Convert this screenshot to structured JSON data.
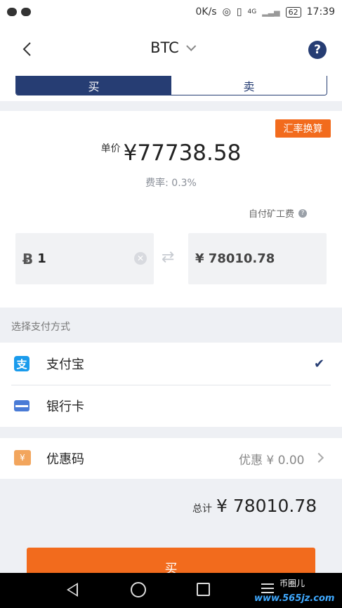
{
  "status_bar": {
    "network_speed": "0K/s",
    "battery": "62",
    "time": "17:39",
    "signal_label": "4G"
  },
  "header": {
    "title": "BTC",
    "help": "?"
  },
  "tabs": [
    {
      "label": "买",
      "active": true
    },
    {
      "label": "卖",
      "active": false
    }
  ],
  "price": {
    "convert_label": "汇率换算",
    "unit_label": "单价",
    "unit_value": "¥77738.58",
    "fee_rate": "费率: 0.3%",
    "miner_fee_label": "自付矿工费"
  },
  "inputs": {
    "btc_symbol": "Ƀ",
    "btc_amount": "1",
    "cny_amount": "¥ 78010.78"
  },
  "payment": {
    "header": "选择支付方式",
    "methods": [
      {
        "label": "支付宝",
        "icon": "alipay-icon",
        "selected": true
      },
      {
        "label": "银行卡",
        "icon": "bank-card-icon",
        "selected": false
      }
    ]
  },
  "coupon": {
    "label": "优惠码",
    "value": "优惠 ¥ 0.00"
  },
  "total": {
    "label": "总计",
    "value": "¥ 78010.78"
  },
  "buy_button": {
    "label": "买"
  },
  "watermark": {
    "name": "币圈儿",
    "url": "www.565jz.com"
  }
}
